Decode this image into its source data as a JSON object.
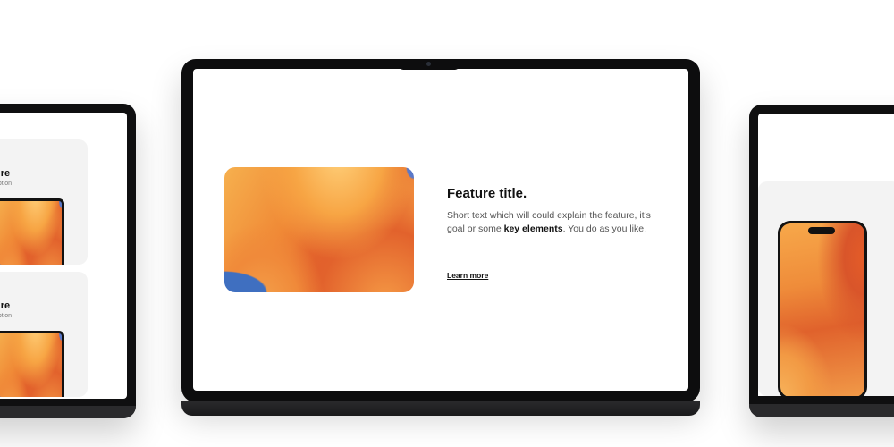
{
  "left_device": {
    "cards": [
      {
        "title": "ure",
        "desc": "ription"
      },
      {
        "title": "ure",
        "desc": "ription"
      }
    ]
  },
  "laptop": {
    "feature": {
      "title": "Feature title.",
      "desc_before": "Short text which will could explain the feature, it's goal or some ",
      "desc_bold": "key elements",
      "desc_after": ". You do as you like.",
      "link": "Learn more"
    }
  },
  "icons": {
    "camera": "camera-dot-icon"
  }
}
